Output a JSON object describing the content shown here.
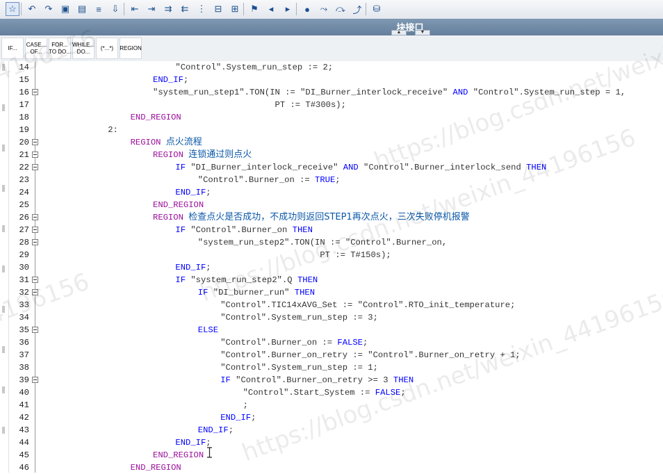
{
  "panel": {
    "title": "块接口"
  },
  "snippets": [
    "IF...",
    "CASE...\nOF...",
    "FOR...\nTO DO...",
    "WHILE...\nDO...",
    "(*...*)",
    "REGION"
  ],
  "lines": [
    {
      "n": "14",
      "indent": 12,
      "fold": false,
      "segs": [
        [
          "tx",
          "\"Control\".System_run_step := 2;"
        ]
      ]
    },
    {
      "n": "15",
      "indent": 10,
      "fold": false,
      "segs": [
        [
          "kw",
          "END_IF"
        ],
        [
          "tx",
          ";"
        ]
      ]
    },
    {
      "n": "16",
      "indent": 10,
      "fold": true,
      "segs": [
        [
          "tx",
          "\"system_run_step1\".TON(IN := \"DI_Burner_interlock_receive\" "
        ],
        [
          "kw",
          "AND"
        ],
        [
          "tx",
          " \"Control\".System_run_step = 1,"
        ]
      ]
    },
    {
      "n": "17",
      "indent": 10,
      "fold": false,
      "segs": [
        [
          "tx",
          "                        PT := T#300s);"
        ]
      ]
    },
    {
      "n": "18",
      "indent": 8,
      "fold": false,
      "segs": [
        [
          "rg",
          "END_REGION"
        ]
      ]
    },
    {
      "n": "19",
      "indent": 6,
      "fold": false,
      "segs": [
        [
          "tx",
          "2:"
        ]
      ]
    },
    {
      "n": "20",
      "indent": 8,
      "fold": true,
      "segs": [
        [
          "rg",
          "REGION "
        ],
        [
          "cn",
          "点火流程"
        ]
      ]
    },
    {
      "n": "21",
      "indent": 10,
      "fold": true,
      "segs": [
        [
          "rg",
          "REGION "
        ],
        [
          "cn",
          "连锁通过则点火"
        ]
      ]
    },
    {
      "n": "22",
      "indent": 12,
      "fold": true,
      "segs": [
        [
          "kw",
          "IF"
        ],
        [
          "tx",
          " \"DI_Burner_interlock_receive\" "
        ],
        [
          "kw",
          "AND"
        ],
        [
          "tx",
          " \"Control\".Burner_interlock_send "
        ],
        [
          "kw",
          "THEN"
        ]
      ]
    },
    {
      "n": "23",
      "indent": 14,
      "fold": false,
      "segs": [
        [
          "tx",
          "\"Control\".Burner_on := "
        ],
        [
          "kw",
          "TRUE"
        ],
        [
          "tx",
          ";"
        ]
      ]
    },
    {
      "n": "24",
      "indent": 12,
      "fold": false,
      "segs": [
        [
          "kw",
          "END_IF"
        ],
        [
          "tx",
          ";"
        ]
      ]
    },
    {
      "n": "25",
      "indent": 10,
      "fold": false,
      "segs": [
        [
          "rg",
          "END_REGION"
        ]
      ]
    },
    {
      "n": "26",
      "indent": 10,
      "fold": true,
      "segs": [
        [
          "rg",
          "REGION "
        ],
        [
          "cn",
          "检查点火是否成功，不成功则返回STEP1再次点火，三次失败停机报警"
        ]
      ]
    },
    {
      "n": "27",
      "indent": 12,
      "fold": true,
      "segs": [
        [
          "kw",
          "IF"
        ],
        [
          "tx",
          " \"Control\".Burner_on "
        ],
        [
          "kw",
          "THEN"
        ]
      ]
    },
    {
      "n": "28",
      "indent": 14,
      "fold": true,
      "segs": [
        [
          "tx",
          "\"system_run_step2\".TON(IN := \"Control\".Burner_on,"
        ]
      ]
    },
    {
      "n": "29",
      "indent": 14,
      "fold": false,
      "segs": [
        [
          "tx",
          "                        PT := T#150s);"
        ]
      ]
    },
    {
      "n": "30",
      "indent": 12,
      "fold": false,
      "segs": [
        [
          "kw",
          "END_IF"
        ],
        [
          "tx",
          ";"
        ]
      ]
    },
    {
      "n": "31",
      "indent": 12,
      "fold": true,
      "segs": [
        [
          "kw",
          "IF"
        ],
        [
          "tx",
          " \"system_run_step2\".Q "
        ],
        [
          "kw",
          "THEN"
        ]
      ]
    },
    {
      "n": "32",
      "indent": 14,
      "fold": true,
      "segs": [
        [
          "kw",
          "IF"
        ],
        [
          "tx",
          " \"DI_burner_run\" "
        ],
        [
          "kw",
          "THEN"
        ]
      ]
    },
    {
      "n": "33",
      "indent": 16,
      "fold": false,
      "segs": [
        [
          "tx",
          "\"Control\".TIC14xAVG_Set := \"Control\".RTO_init_temperature;"
        ]
      ]
    },
    {
      "n": "34",
      "indent": 16,
      "fold": false,
      "segs": [
        [
          "tx",
          "\"Control\".System_run_step := 3;"
        ]
      ]
    },
    {
      "n": "35",
      "indent": 14,
      "fold": true,
      "segs": [
        [
          "kw",
          "ELSE"
        ]
      ]
    },
    {
      "n": "36",
      "indent": 16,
      "fold": false,
      "segs": [
        [
          "tx",
          "\"Control\".Burner_on := "
        ],
        [
          "kw",
          "FALSE"
        ],
        [
          "tx",
          ";"
        ]
      ]
    },
    {
      "n": "37",
      "indent": 16,
      "fold": false,
      "segs": [
        [
          "tx",
          "\"Control\".Burner_on_retry := \"Control\".Burner_on_retry + 1;"
        ]
      ]
    },
    {
      "n": "38",
      "indent": 16,
      "fold": false,
      "segs": [
        [
          "tx",
          "\"Control\".System_run_step := 1;"
        ]
      ]
    },
    {
      "n": "39",
      "indent": 16,
      "fold": true,
      "segs": [
        [
          "kw",
          "IF"
        ],
        [
          "tx",
          " \"Control\".Burner_on_retry >= 3 "
        ],
        [
          "kw",
          "THEN"
        ]
      ]
    },
    {
      "n": "40",
      "indent": 18,
      "fold": false,
      "segs": [
        [
          "tx",
          "\"Control\".Start_System := "
        ],
        [
          "kw",
          "FALSE"
        ],
        [
          "tx",
          ";"
        ]
      ]
    },
    {
      "n": "41",
      "indent": 18,
      "fold": false,
      "segs": [
        [
          "tx",
          ";"
        ]
      ]
    },
    {
      "n": "42",
      "indent": 16,
      "fold": false,
      "segs": [
        [
          "kw",
          "END_IF"
        ],
        [
          "tx",
          ";"
        ]
      ]
    },
    {
      "n": "43",
      "indent": 14,
      "fold": false,
      "segs": [
        [
          "kw",
          "END_IF"
        ],
        [
          "tx",
          ";"
        ]
      ]
    },
    {
      "n": "44",
      "indent": 12,
      "fold": false,
      "segs": [
        [
          "kw",
          "END_IF"
        ],
        [
          "tx",
          ";"
        ]
      ]
    },
    {
      "n": "45",
      "indent": 10,
      "fold": false,
      "segs": [
        [
          "rg",
          "END_REGION"
        ]
      ]
    },
    {
      "n": "46",
      "indent": 8,
      "fold": false,
      "segs": [
        [
          "rg",
          "END_REGION"
        ]
      ]
    }
  ],
  "watermarks": [
    "https://blog.csdn.net/weixin_44196156",
    "https://blog.csdn.net/weixin_44196156",
    "https://blog.csdn.net/weixin_44196156",
    "4196156"
  ],
  "toolbar_icons": [
    "favorites-icon",
    "insert-block-call-icon",
    "delete-block-call-icon",
    "monitor-icon",
    "monitor-all-icon",
    "list-icon",
    "download-icon",
    "indent-less-icon",
    "indent-more-icon",
    "indent-icon",
    "outdent-icon",
    "columns-icon",
    "fold-icon",
    "unfold-icon",
    "bookmark-icon",
    "prev-bookmark-icon",
    "next-bookmark-icon",
    "breakpoint-icon",
    "step-icon",
    "step-over-icon",
    "step-out-icon",
    "db-icon"
  ]
}
